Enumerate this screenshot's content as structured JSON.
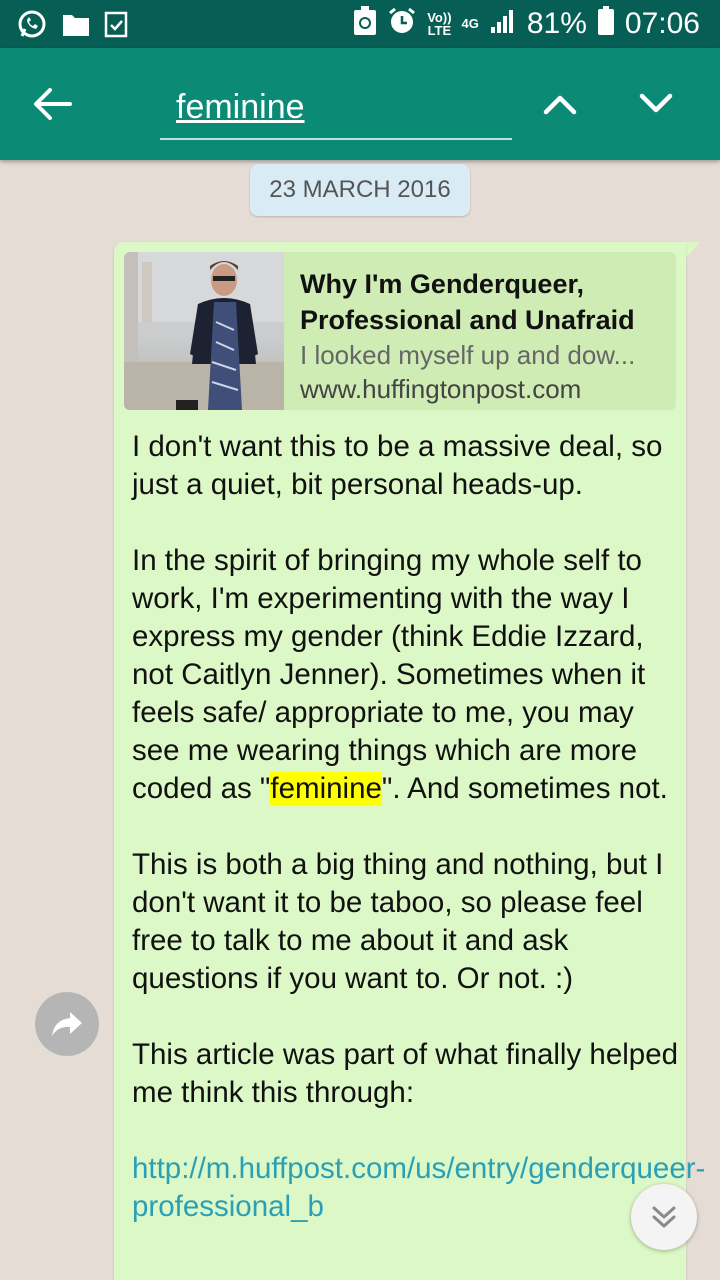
{
  "status_bar": {
    "battery": "81%",
    "time": "07:06",
    "volte_top": "Vo))",
    "volte_bottom": "LTE",
    "network": "4G"
  },
  "app_bar": {
    "search_value": "feminine"
  },
  "chat": {
    "date_label": "23 MARCH 2016",
    "message": {
      "link_preview": {
        "title": "Why I'm Genderqueer, Professional and Unafraid",
        "description": "I looked myself up and dow...",
        "domain": "www.huffingtonpost.com"
      },
      "para1": "I don't want this to be a massive deal, so just a quiet, bit personal heads-up.",
      "para2_before": "In the spirit of bringing my whole self to work, I'm experimenting with the way I express my gender (think Eddie Izzard, not Caitlyn Jenner). Sometimes when it feels safe/ appropriate to me, you may see me wearing things which are more coded as \"",
      "para2_highlight": "feminine",
      "para2_after": "\". And sometimes not.",
      "para3": "This is both a big thing and nothing, but I don't want it to be taboo, so please feel free to talk to me about it and ask questions if you want to. Or not. :)",
      "para4": "This article was part of what finally helped me think this through:",
      "link_text": "http://m.huffpost.com/us/entry/genderqueer-professional_b"
    }
  },
  "colors": {
    "status_bar": "#075e54",
    "app_bar": "#0b8a76",
    "bubble": "#dcf8c6",
    "background": "#e5ddd5",
    "highlight": "#ffff00",
    "link": "#2b9fb5"
  },
  "icons": [
    "whatsapp-icon",
    "folder-icon",
    "clipboard-check-icon",
    "recycle-icon",
    "alarm-icon",
    "signal-icon",
    "battery-icon",
    "back-arrow-icon",
    "chevron-up-icon",
    "chevron-down-icon",
    "forward-icon",
    "double-chevron-down-icon"
  ]
}
